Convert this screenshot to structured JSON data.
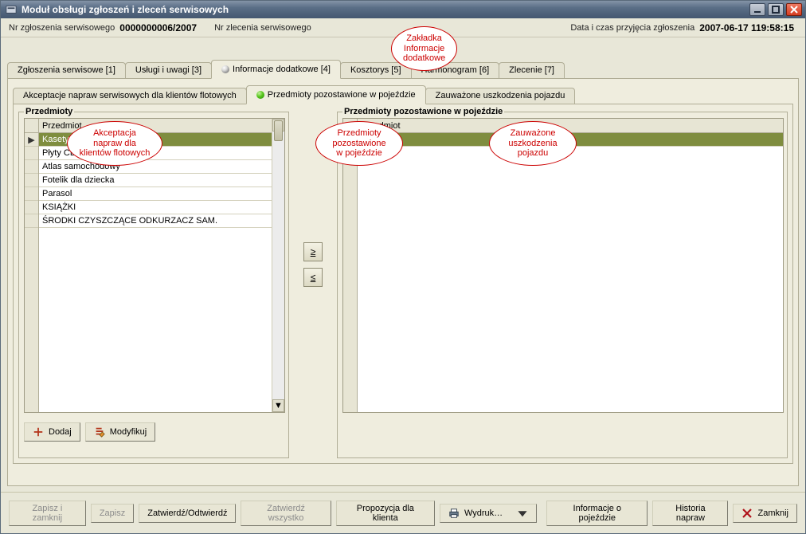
{
  "title": "Moduł obsługi zgłoszeń i zleceń serwisowych",
  "info": {
    "nr_zgl_label": "Nr zgłoszenia serwisowego",
    "nr_zgl_value": "0000000006/2007",
    "nr_zlec_label": "Nr zlecenia serwisowego",
    "date_label": "Data i czas przyjęcia zgłoszenia",
    "date_value": "2007-06-17 119:58:15"
  },
  "tabsL1": [
    {
      "label": "Zgłoszenia serwisowe  [1]"
    },
    {
      "label": "Usługi i uwagi [3]"
    },
    {
      "label": "Informacje dodatkowe [4]"
    },
    {
      "label": "Kosztorys  [5]"
    },
    {
      "label": "Harmonogram [6]"
    },
    {
      "label": "Zlecenie [7]"
    }
  ],
  "tabsL2": [
    {
      "label": "Akceptacje napraw serwisowych dla klientów flotowych"
    },
    {
      "label": "Przedmioty pozostawione w pojeździe"
    },
    {
      "label": "Zauważone uszkodzenia pojazdu"
    }
  ],
  "left": {
    "legend": "Przedmioty",
    "column": "Przedmiot",
    "rows": [
      "Kasety",
      "Płyty CD",
      "Atlas samochodowy",
      "Fotelik dla dziecka",
      "Parasol",
      "KSIĄŻKI",
      "ŚRODKI CZYSZCZĄCE ODKURZACZ SAM."
    ]
  },
  "right": {
    "legend": "Przedmioty pozostawione w pojeździe",
    "column": "Przedmiot"
  },
  "buttons": {
    "dodaj": "Dodaj",
    "modyfikuj": "Modyfikuj",
    "xfer_right": "≥",
    "xfer_left": "≤"
  },
  "actionbar": {
    "zapisz_zamknij": "Zapisz i zamknij",
    "zapisz": "Zapisz",
    "zatwierdz": "Zatwierdź/Odtwierdź",
    "zatwierdz_wszystko": "Zatwierdź wszystko",
    "propozycja": "Propozycja dla klienta",
    "wydruk": "Wydruk…",
    "info_pojazd": "Informacje o pojeździe",
    "historia": "Historia napraw",
    "zamknij": "Zamknij"
  },
  "callouts": {
    "c1": "Zakładka\nInformacje\ndodatkowe",
    "c2": "Akceptacja\nnapraw dla\nklientów flotowych",
    "c3": "Przedmioty\npozostawione\nw pojeździe",
    "c4": "Zauważone\nuszkodzenia\npojazdu"
  }
}
